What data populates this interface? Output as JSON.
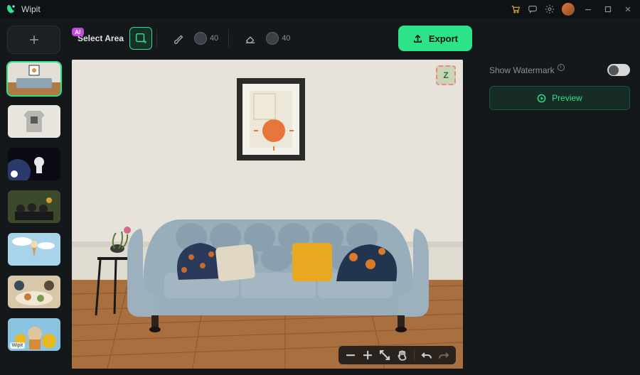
{
  "app": {
    "name": "Wipit"
  },
  "titlebar": {
    "icons": [
      "cart-icon",
      "chat-icon",
      "gear-icon",
      "avatar"
    ],
    "window": [
      "minimize",
      "maximize",
      "close"
    ]
  },
  "sidebar": {
    "add_label": "+",
    "thumbs": [
      {
        "id": "thumb-room",
        "selected": true,
        "desc": "living room with sofa"
      },
      {
        "id": "thumb-tshirt",
        "selected": false,
        "desc": "grey tshirt hanging"
      },
      {
        "id": "thumb-space",
        "selected": false,
        "desc": "astronaut in space",
        "badge": "dot"
      },
      {
        "id": "thumb-grads",
        "selected": false,
        "desc": "graduation crowd"
      },
      {
        "id": "thumb-icecream",
        "selected": false,
        "desc": "ice cream cone sky"
      },
      {
        "id": "thumb-food",
        "selected": false,
        "desc": "people dining table"
      },
      {
        "id": "thumb-girl",
        "selected": false,
        "desc": "girl sunflowers",
        "badge": "wm",
        "wm_text": "Wipit"
      }
    ]
  },
  "toolbar": {
    "ai_badge": "AI",
    "mode_label": "Select Area",
    "tools": {
      "rect": "rectangle-select",
      "brush": "brush-select",
      "erase": "eraser"
    },
    "brush_size": 40,
    "erase_size": 40,
    "export_label": "Export"
  },
  "canvas": {
    "watermark_glyph": "Z",
    "controls": [
      "zoom-out",
      "zoom-in",
      "fit-screen",
      "pan",
      "undo",
      "redo"
    ]
  },
  "right_panel": {
    "show_watermark_label": "Show Watermark",
    "show_watermark_on": false,
    "preview_label": "Preview"
  }
}
